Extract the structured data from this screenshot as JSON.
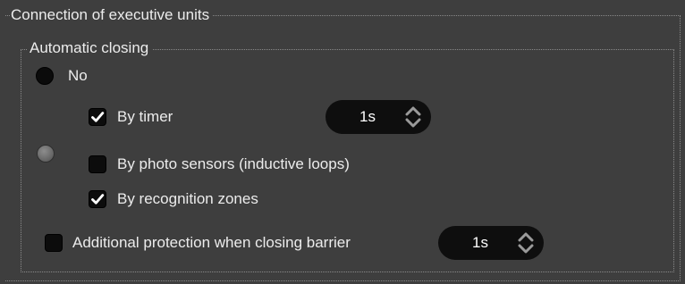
{
  "connection_group": {
    "title": "Connection of executive units"
  },
  "automatic_closing": {
    "title": "Automatic closing",
    "option_no": {
      "label": "No",
      "selected": true
    },
    "option_custom": {
      "selected": false
    },
    "by_timer": {
      "label": "By timer",
      "checked": true,
      "value": "1s"
    },
    "by_photo_sensors": {
      "label": "By photo sensors (inductive loops)",
      "checked": false
    },
    "by_recognition_zones": {
      "label": "By recognition zones",
      "checked": true
    }
  },
  "additional_protection": {
    "label": "Additional protection when closing barrier",
    "checked": false,
    "value": "1s"
  },
  "icons": {
    "check": "checkmark-icon",
    "spin_up": "chevron-up-icon",
    "spin_down": "chevron-down-icon"
  },
  "colors": {
    "background": "#3e3e3e",
    "control_fill": "#0c0c0c",
    "text": "#ececec",
    "frame_dots": "#8a8a8a",
    "arrow": "#9a9a9a"
  }
}
